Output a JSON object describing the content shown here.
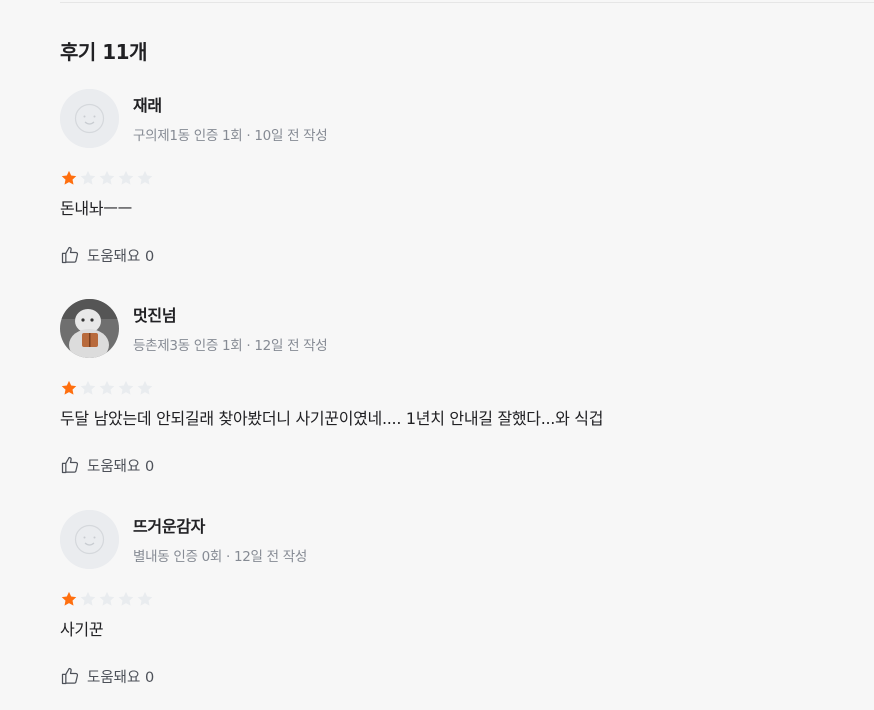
{
  "section": {
    "title": "후기 11개"
  },
  "colors": {
    "star_filled": "#ff6f0f",
    "star_empty": "#e9ecef",
    "meta_text": "#868b94"
  },
  "reviews": [
    {
      "nickname": "재래",
      "meta": "구의제1동 인증 1회 · 10일 전 작성",
      "avatar": "default-avatar",
      "rating": 1,
      "content": "돈내놔ㅡㅡ",
      "helpful_label": "도움돼요 0"
    },
    {
      "nickname": "멋진넘",
      "meta": "등촌제3동 인증 1회 · 12일 전 작성",
      "avatar": "photo-avatar",
      "rating": 1,
      "content": "두달 남았는데 안되길래 찾아봤더니 사기꾼이였네.... 1년치 안내길 잘했다...와 식겁",
      "helpful_label": "도움돼요 0"
    },
    {
      "nickname": "뜨거운감자",
      "meta": "별내동 인증 0회 · 12일 전 작성",
      "avatar": "default-avatar",
      "rating": 1,
      "content": "사기꾼",
      "helpful_label": "도움돼요 0"
    }
  ]
}
